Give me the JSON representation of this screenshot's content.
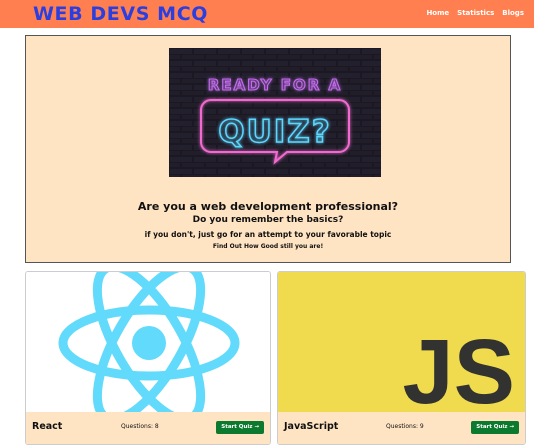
{
  "navbar": {
    "brand": "WEB DEVS MCQ",
    "links": [
      "Home",
      "Statistics",
      "Blogs"
    ]
  },
  "hero": {
    "image_text": {
      "line1": "READY FOR A",
      "line2": "QUIZ?"
    },
    "title": "Are you a web development professional?",
    "subtitle": "Do you remember the basics?",
    "line3": "if you don't, just go for an attempt to your favorable topic",
    "line4": "Find Out How Good still you are!"
  },
  "cards": [
    {
      "name": "React",
      "questions": "Questions: 8",
      "button": "Start Quiz →"
    },
    {
      "name": "JavaScript",
      "questions": "Questions: 9",
      "button": "Start Quiz →",
      "logo_text": "JS"
    }
  ],
  "colors": {
    "navbar": "#ff7f50",
    "brand": "#2b3fe0",
    "panel": "#ffe4c4",
    "button": "#0c7a2e",
    "react": "#61dafb",
    "js_bg": "#f0db4f"
  }
}
